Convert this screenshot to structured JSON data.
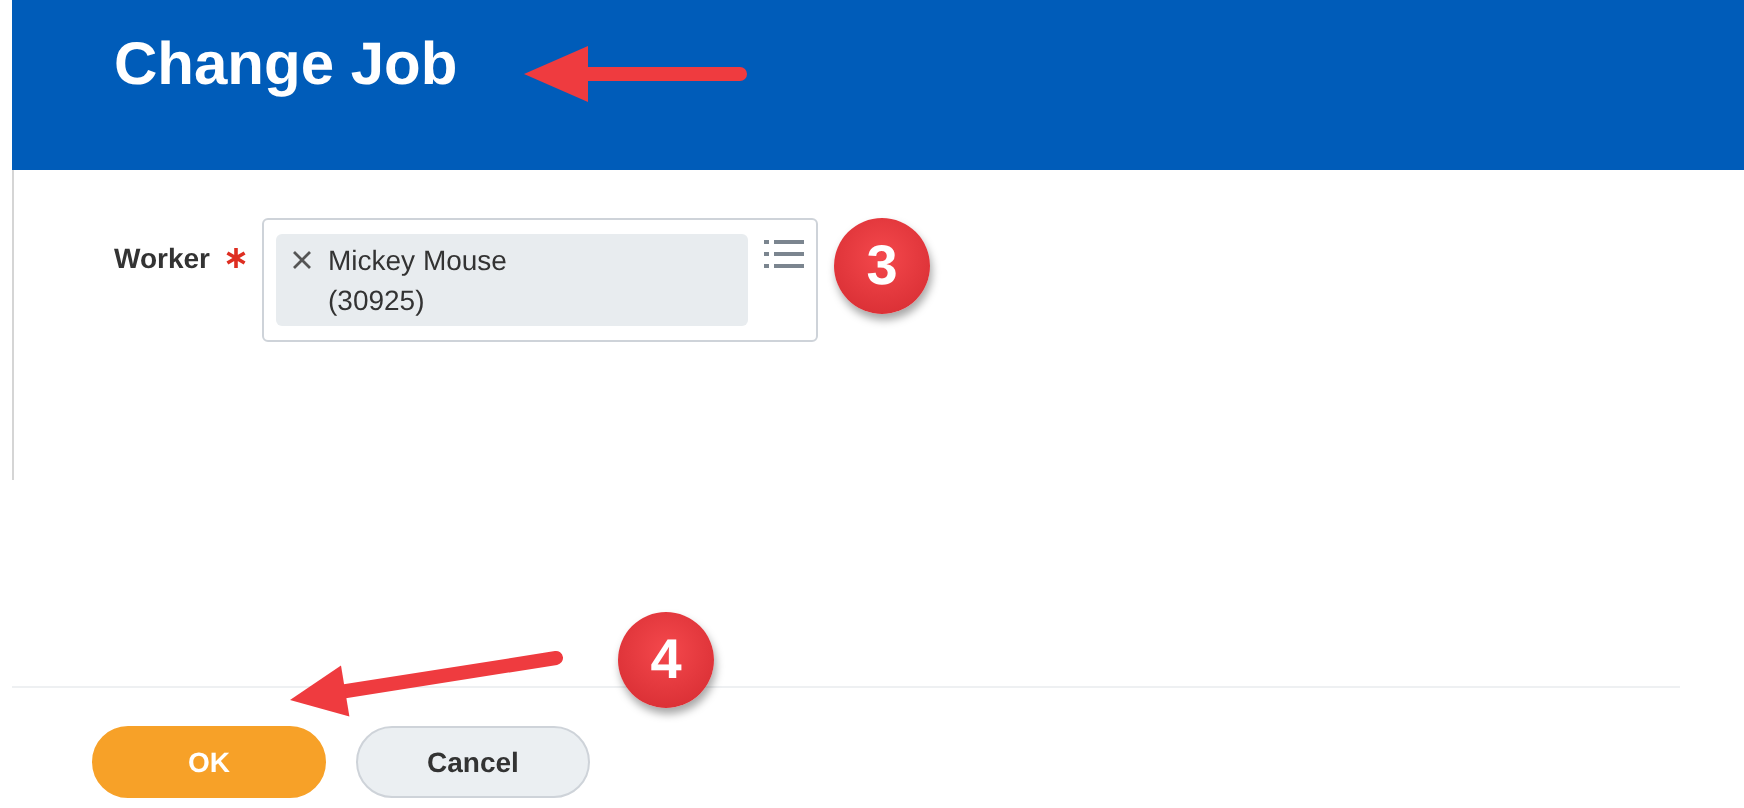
{
  "page": {
    "title": "Change Job"
  },
  "fields": [
    {
      "label": "Worker",
      "required": true,
      "kind": "multiselect",
      "values": [
        "Mickey Mouse (30925)"
      ]
    }
  ],
  "buttons": [
    {
      "label": "OK",
      "kind": "primary"
    },
    {
      "label": "Cancel",
      "kind": "secondary"
    }
  ],
  "callouts": [
    {
      "label": "3"
    },
    {
      "label": "4"
    }
  ]
}
